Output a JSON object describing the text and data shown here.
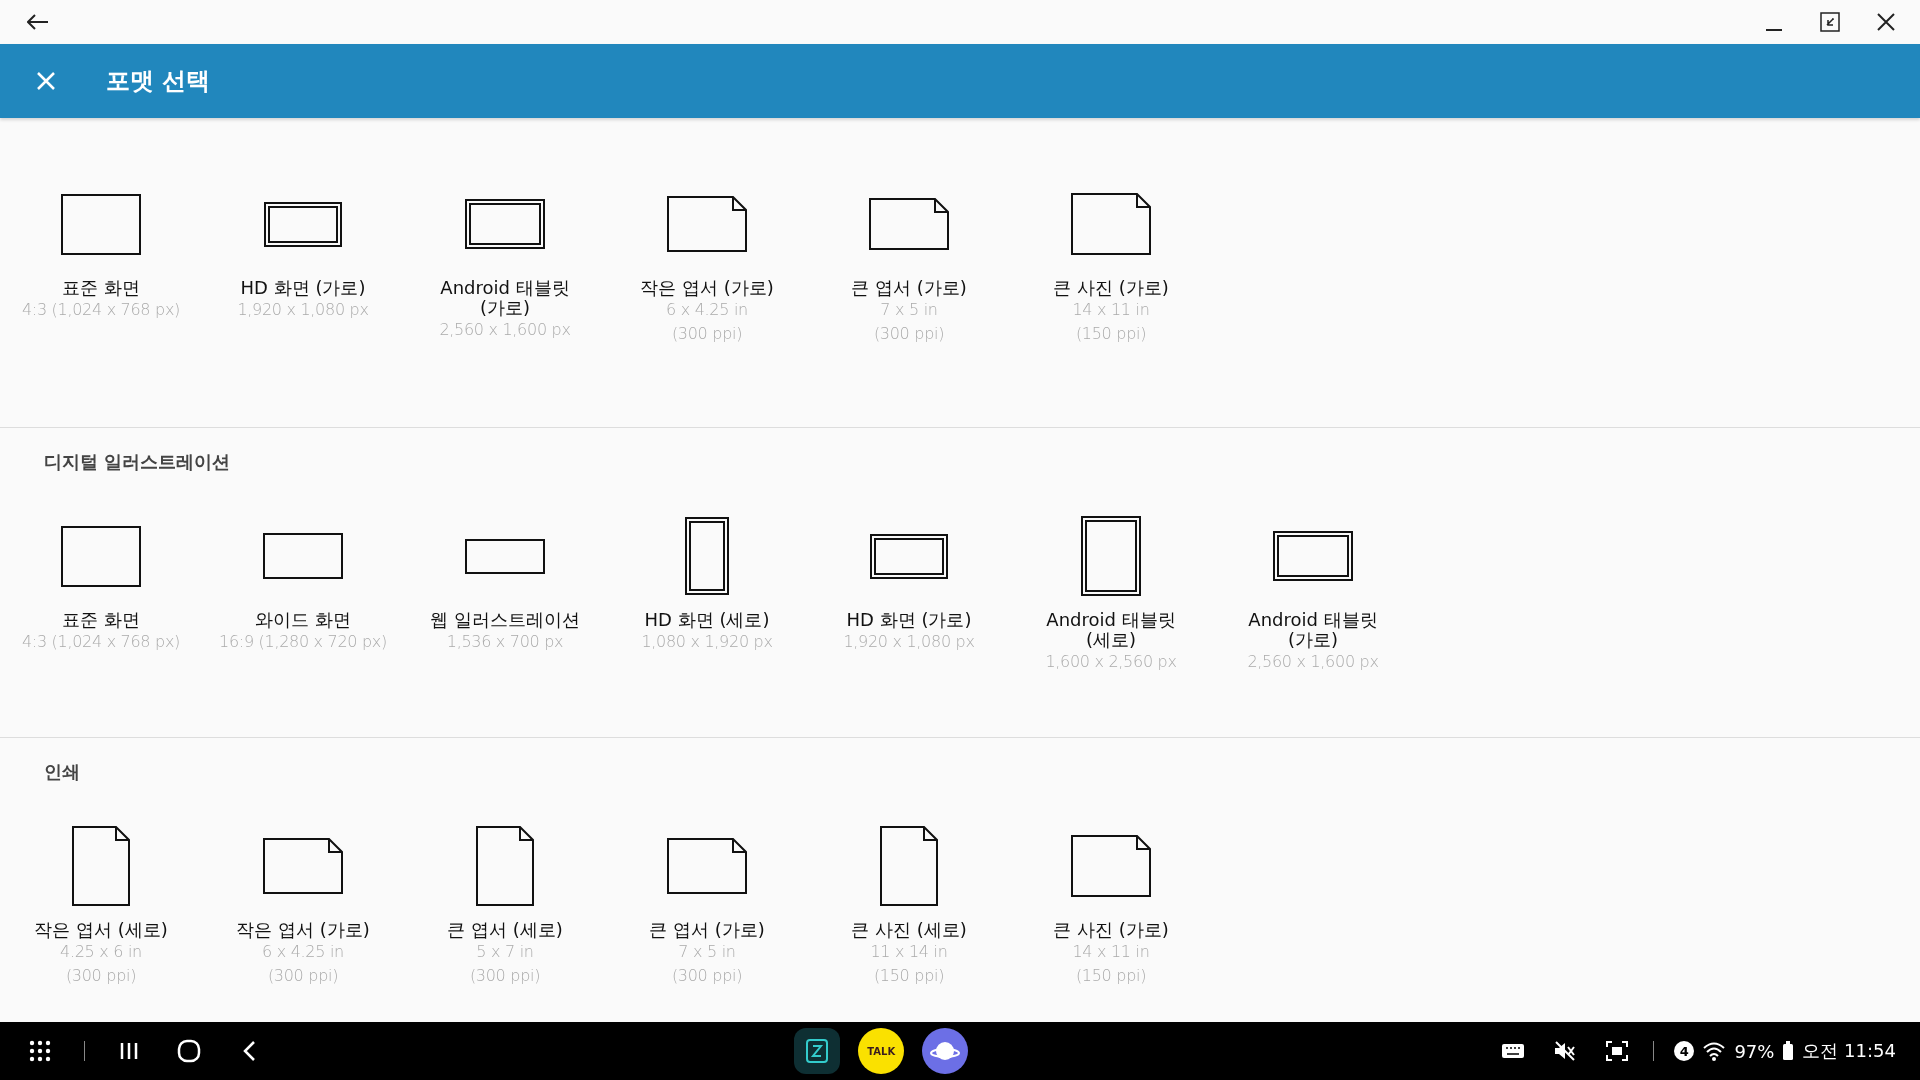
{
  "header": {
    "title": "포맷 선택"
  },
  "sections": [
    {
      "items": [
        {
          "name": "표준 화면",
          "details": [
            "4:3 (1,024 x 768 px)"
          ],
          "kind": "screen"
        },
        {
          "name": "HD 화면 (가로)",
          "details": [
            "1,920 x 1,080 px"
          ],
          "kind": "hdwide"
        },
        {
          "name": "Android 태블릿 (가로)",
          "details": [
            "2,560 x 1,600 px"
          ],
          "kind": "tabletwide"
        },
        {
          "name": "작은 엽서 (가로)",
          "details": [
            "6 x 4.25 in",
            "(300 ppi)"
          ],
          "kind": "pagewide"
        },
        {
          "name": "큰 엽서 (가로)",
          "details": [
            "7 x 5 in",
            "(300 ppi)"
          ],
          "kind": "pagemedium"
        },
        {
          "name": "큰 사진 (가로)",
          "details": [
            "14 x 11 in",
            "(150 ppi)"
          ],
          "kind": "pagesquare"
        }
      ]
    },
    {
      "heading": "디지털 일러스트레이션",
      "items": [
        {
          "name": "표준 화면",
          "details": [
            "4:3 (1,024 x 768 px)"
          ],
          "kind": "screen"
        },
        {
          "name": "와이드 화면",
          "details": [
            "16:9 (1,280 x 720 px)"
          ],
          "kind": "widescreen"
        },
        {
          "name": "웹 일러스트레이션",
          "details": [
            "1,536 x 700 px"
          ],
          "kind": "banner"
        },
        {
          "name": "HD 화면 (세로)",
          "details": [
            "1,080 x 1,920 px"
          ],
          "kind": "hdtall"
        },
        {
          "name": "HD 화면 (가로)",
          "details": [
            "1,920 x 1,080 px"
          ],
          "kind": "hdwide"
        },
        {
          "name": "Android 태블릿 (세로)",
          "details": [
            "1,600 x 2,560 px"
          ],
          "kind": "tablettall"
        },
        {
          "name": "Android 태블릿 (가로)",
          "details": [
            "2,560 x 1,600 px"
          ],
          "kind": "tabletwide"
        }
      ]
    },
    {
      "heading": "인쇄",
      "items": [
        {
          "name": "작은 엽서 (세로)",
          "details": [
            "4.25 x 6 in",
            "(300 ppi)"
          ],
          "kind": "pagetall"
        },
        {
          "name": "작은 엽서 (가로)",
          "details": [
            "6 x 4.25 in",
            "(300 ppi)"
          ],
          "kind": "pagewide"
        },
        {
          "name": "큰 엽서 (세로)",
          "details": [
            "5 x 7 in",
            "(300 ppi)"
          ],
          "kind": "pagetall"
        },
        {
          "name": "큰 엽서 (가로)",
          "details": [
            "7 x 5 in",
            "(300 ppi)"
          ],
          "kind": "pagewide"
        },
        {
          "name": "큰 사진 (세로)",
          "details": [
            "11 x 14 in",
            "(150 ppi)"
          ],
          "kind": "pagetall"
        },
        {
          "name": "큰 사진 (가로)",
          "details": [
            "14 x 11 in",
            "(150 ppi)"
          ],
          "kind": "pagesquare"
        }
      ]
    }
  ],
  "taskbar": {
    "apps": [
      {
        "kind": "notes"
      },
      {
        "kind": "chat",
        "label": "TALK"
      },
      {
        "kind": "browser"
      }
    ],
    "notifications": "4",
    "battery": "97%",
    "clock": "오전 11:54"
  }
}
